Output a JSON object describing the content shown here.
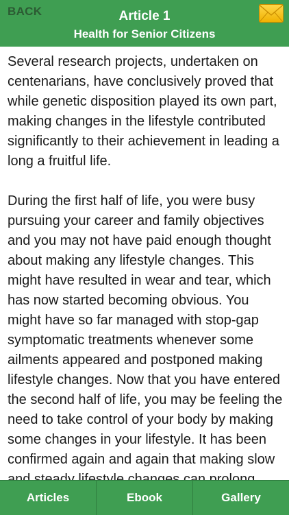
{
  "header": {
    "back_label": "BACK",
    "title": "Article 1",
    "subtitle": "Health for Senior Citizens",
    "mail_icon": "envelope-icon"
  },
  "article": {
    "paragraphs": [
      "Several research projects, undertaken on centenarians, have conclusively proved that while genetic disposition played its own part, making changes in the lifestyle contributed significantly to their achievement in leading a long a fruitful life.",
      "During the first half of life, you were busy pursuing your career and family objectives and you may not have paid enough thought about making any lifestyle changes. This might have resulted in wear and tear, which has now started becoming obvious. You might have so far managed with stop-gap symptomatic treatments whenever some ailments appeared and postponed making lifestyle changes. Now that you have entered the second half of life, you may be feeling the need to take control of your body by making some changes in your lifestyle. It has been confirmed again and again that making slow and steady lifestyle changes can prolong your healthy life. Making"
    ]
  },
  "tabbar": {
    "tabs": [
      {
        "label": "Articles"
      },
      {
        "label": "Ebook"
      },
      {
        "label": "Gallery"
      }
    ]
  },
  "colors": {
    "header_bg": "#3f9e52",
    "tabbar_bg": "#3f9e52",
    "back_text": "#2c5a33",
    "mail_icon": "#f5c31c"
  }
}
